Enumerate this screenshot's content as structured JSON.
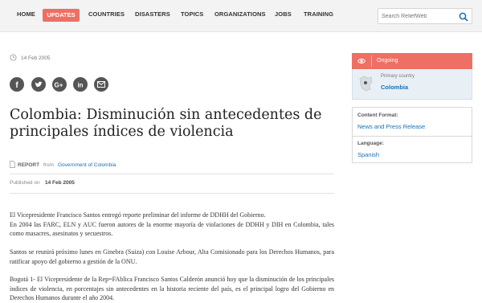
{
  "nav": {
    "items": [
      {
        "label": "HOME"
      },
      {
        "label": "UPDATES"
      },
      {
        "label": "COUNTRIES"
      },
      {
        "label": "DISASTERS"
      },
      {
        "label": "TOPICS"
      },
      {
        "label": "ORGANIZATIONS"
      },
      {
        "label": "JOBS"
      },
      {
        "label": "TRAINING"
      }
    ],
    "active": "UPDATES",
    "accent_color": "#ee6f63"
  },
  "search": {
    "placeholder": "Search ReliefWeb",
    "icon": "search-icon"
  },
  "article": {
    "date": "14 Feb 2005",
    "share_icons": [
      "facebook-icon",
      "twitter-icon",
      "google-plus-icon",
      "linkedin-icon",
      "email-icon"
    ],
    "title": "Colombia: Disminución sin antecedentes de principales índices de violencia",
    "type_label": "REPORT",
    "from_label": "from",
    "source": "Government of Colombia",
    "published_label": "Published on",
    "published_date": "14 Feb 2005",
    "paragraphs": [
      "El Vicepresidente Francisco Santos entregó reporte preliminar del informe de DDHH del Gobierno.\nEn 2004 las FARC, ELN y AUC fueron autores de la enorme mayoría de violaciones de DDHH y DIH en Colombia, tales como masacres, asesinatos y secuestros.",
      "Santos se reunirá próximo lunes en Ginebra (Suiza) con Louise Arbour, Alta Comisionado para los Derechos Humanos, para ratificar apoyo del gobierno a gestión de la ONU.",
      "Bogotá 1- El Vicepresidente de la Rep=FAblica Francisco Santos Calderón anunció hoy que la disminución de los principales índices de violencia, en porcentajes sin antecedentes en la historia reciente del país, es el principal logro del Gobierno en Derechos Humanos durante el año 2004."
    ]
  },
  "sidebar": {
    "status": "Ongoing",
    "primary_country_label": "Primary country",
    "primary_country": "Colombia",
    "content_format_label": "Content Format:",
    "content_format": "News and Press Release",
    "language_label": "Language:",
    "language": "Spanish"
  }
}
